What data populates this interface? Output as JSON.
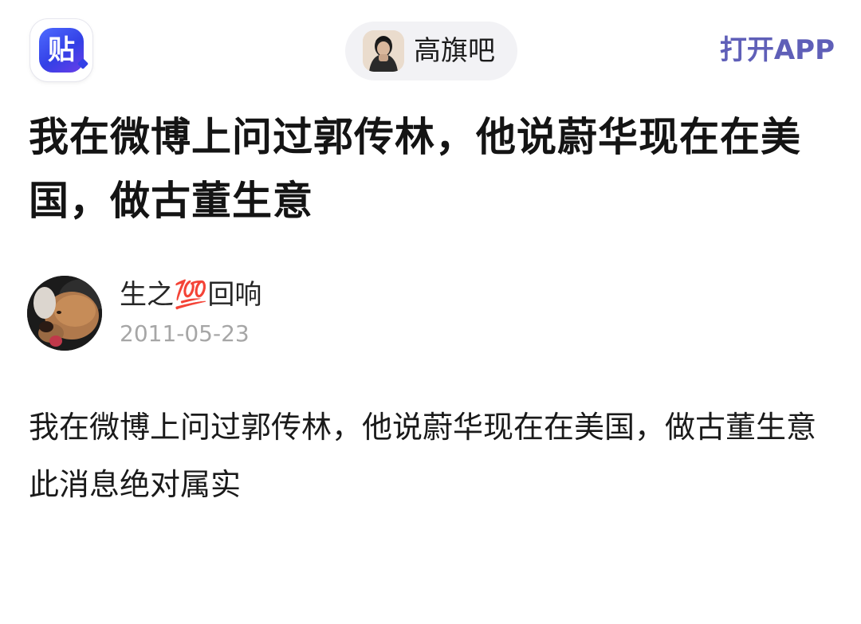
{
  "header": {
    "app_icon": "tieba-logo-icon",
    "app_glyph": "贴",
    "forum_name": "高旗吧",
    "open_app_label": "打开APP",
    "accent_color": "#5f5fb8"
  },
  "post": {
    "title": "我在微博上问过郭传林，他说蔚华现在在美国，做古董生意",
    "author": {
      "name": "生之💯回响",
      "date": "2011-05-23"
    },
    "body": [
      "我在微博上问过郭传林，他说蔚华现在在美国，做古董生意",
      "此消息绝对属实"
    ]
  }
}
